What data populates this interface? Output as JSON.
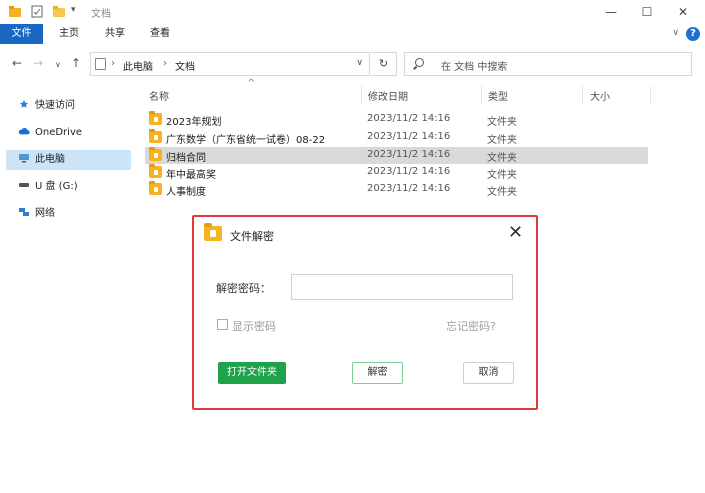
{
  "window": {
    "title": "文档",
    "minimize_glyph": "—",
    "maximize_glyph": "☐",
    "close_glyph": "✕"
  },
  "ribbon": {
    "tabs": [
      {
        "label": "文件",
        "active": true
      },
      {
        "label": "主页",
        "active": false
      },
      {
        "label": "共享",
        "active": false
      },
      {
        "label": "查看",
        "active": false
      }
    ],
    "help_label": "?",
    "collapse_glyph": "∨"
  },
  "address": {
    "back_glyph": "←",
    "forward_glyph": "→",
    "recent_glyph": "∨",
    "up_glyph": "↑",
    "crumbs": [
      "此电脑",
      "文档"
    ],
    "separator": "›",
    "dropdown_glyph": "∨",
    "refresh_glyph": "↻"
  },
  "search": {
    "placeholder": "在 文档 中搜索"
  },
  "sidebar": {
    "items": [
      {
        "label": "快速访问",
        "icon": "star-icon"
      },
      {
        "label": "OneDrive",
        "icon": "cloud-icon"
      },
      {
        "label": "此电脑",
        "icon": "pc-icon",
        "selected": true
      },
      {
        "label": "U 盘 (G:)",
        "icon": "usb-drive-icon"
      },
      {
        "label": "网络",
        "icon": "network-icon"
      }
    ]
  },
  "columns": {
    "name": "名称",
    "modified": "修改日期",
    "type": "类型",
    "size": "大小",
    "sort_glyph": "^"
  },
  "files": [
    {
      "name": "2023年规划",
      "modified": "2023/11/2 14:16",
      "type": "文件夹",
      "selected": false
    },
    {
      "name": "广东数学（广东省统一试卷）08-22",
      "modified": "2023/11/2 14:16",
      "type": "文件夹",
      "selected": false
    },
    {
      "name": "归档合同",
      "modified": "2023/11/2 14:16",
      "type": "文件夹",
      "selected": true
    },
    {
      "name": "年中最高奖",
      "modified": "2023/11/2 14:16",
      "type": "文件夹",
      "selected": false
    },
    {
      "name": "人事制度",
      "modified": "2023/11/2 14:16",
      "type": "文件夹",
      "selected": false
    }
  ],
  "dialog": {
    "title": "文件解密",
    "close_glyph": "✕",
    "password_label": "解密密码：",
    "password_value": "",
    "show_password_label": "显示密码",
    "forgot_label": "忘记密码?",
    "open_folder_button": "打开文件夹",
    "decrypt_button": "解密",
    "cancel_button": "取消",
    "highlight_color": "#e23a3a",
    "primary_color": "#1fa24a"
  },
  "colors": {
    "accent": "#1967c2",
    "folder": "#f5b322",
    "selection": "#cce4f7"
  }
}
